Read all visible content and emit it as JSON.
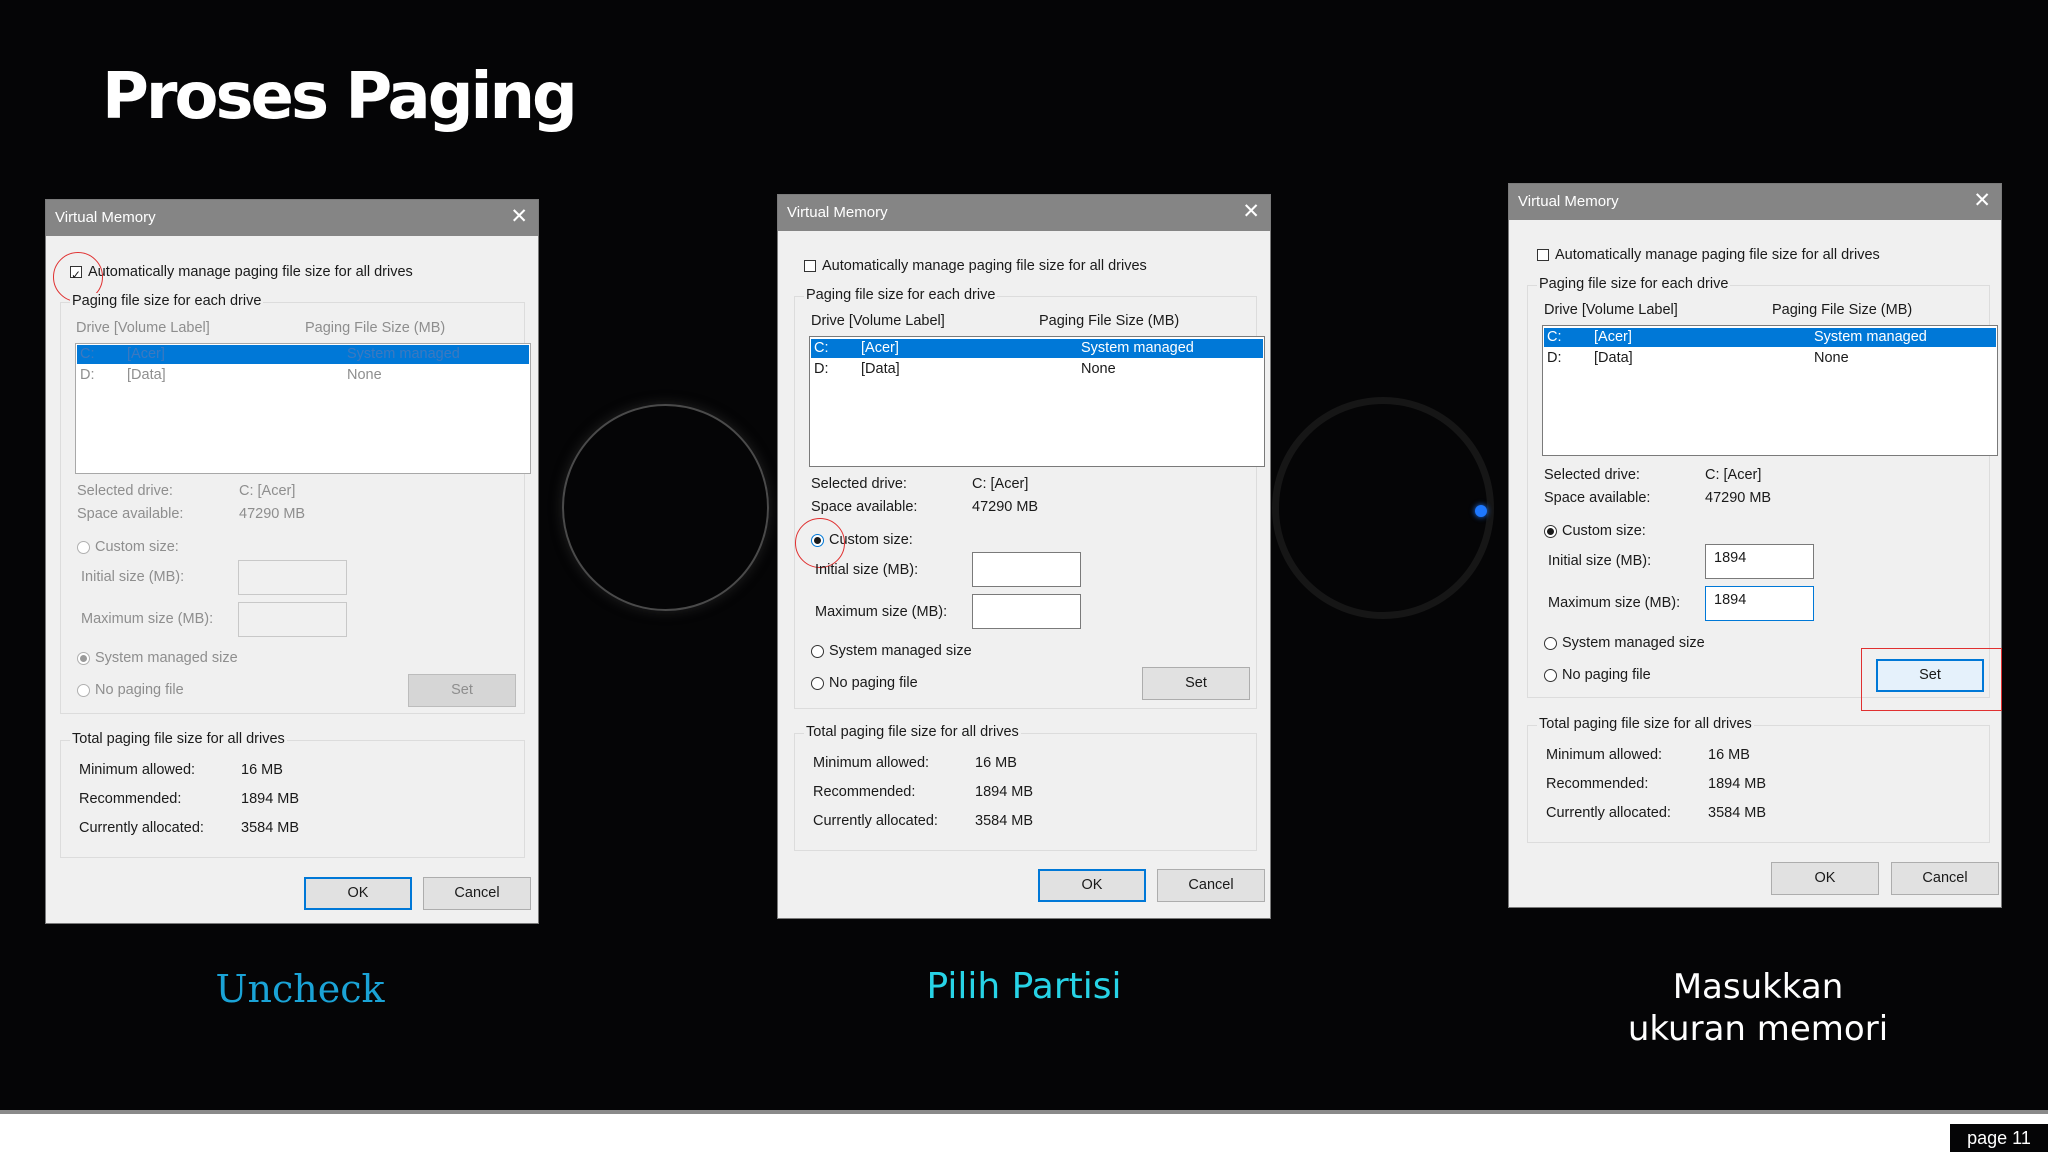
{
  "slide": {
    "title": "Proses Paging",
    "captions": [
      "Uncheck",
      "Pilih Partisi",
      "Masukkan\nukuran memori"
    ],
    "page": "page 11"
  },
  "dialog": {
    "title": "Virtual Memory",
    "close_glyph": "✕",
    "auto_manage_label": "Automatically manage paging file size for all drives",
    "each_drive_group": "Paging file size for each drive",
    "col_drive": "Drive  [Volume Label]",
    "col_size": "Paging File Size (MB)",
    "drives": [
      {
        "letter": "C:",
        "label": "[Acer]",
        "size": "System managed"
      },
      {
        "letter": "D:",
        "label": "[Data]",
        "size": "None"
      }
    ],
    "selected_drive_label": "Selected drive:",
    "selected_drive_value": "C:  [Acer]",
    "space_label": "Space available:",
    "space_value": "47290 MB",
    "custom_size_label": "Custom size:",
    "initial_size_label": "Initial size (MB):",
    "maximum_size_label": "Maximum size (MB):",
    "system_managed_label": "System managed size",
    "no_paging_label": "No paging file",
    "set_button": "Set",
    "total_group": "Total paging file size for all drives",
    "min_label": "Minimum allowed:",
    "min_value": "16 MB",
    "rec_label": "Recommended:",
    "rec_value": "1894 MB",
    "alloc_label": "Currently allocated:",
    "alloc_value": "3584 MB",
    "ok_button": "OK",
    "cancel_button": "Cancel"
  },
  "dialog3_inputs": {
    "initial": "1894",
    "maximum": "1894"
  },
  "colors": {
    "selection": "#0078d7",
    "caption_1": "#1aa3d6",
    "caption_2": "#27d3e6",
    "caption_3": "#ffffff",
    "highlight": "#e03030"
  }
}
